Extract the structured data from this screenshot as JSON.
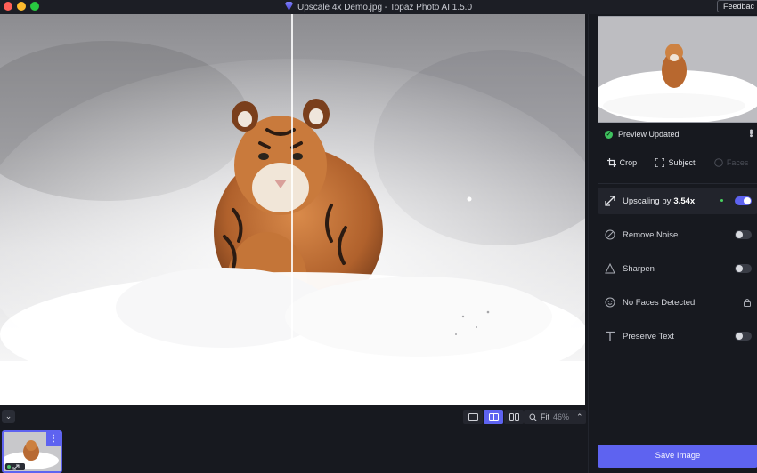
{
  "window": {
    "title": "Upscale 4x Demo.jpg - Topaz Photo AI 1.5.0",
    "feedback_label": "Feedbac"
  },
  "colors": {
    "accent": "#5e63f0",
    "success": "#3fc25f",
    "panel_bg": "#17191f"
  },
  "viewer": {
    "zoom_label": "Fit",
    "zoom_value": "46%",
    "view_modes": [
      "single-view-icon",
      "split-view-icon",
      "side-by-side-icon"
    ],
    "active_view_mode": "split-view-icon"
  },
  "panel": {
    "status": "Preview Updated",
    "tools": [
      {
        "label": "Crop",
        "icon": "crop-icon",
        "enabled": true
      },
      {
        "label": "Subject",
        "icon": "subject-icon",
        "enabled": true
      },
      {
        "label": "Faces",
        "icon": "faces-icon",
        "enabled": false
      }
    ],
    "upscale": {
      "prefix": "Upscaling by",
      "value": "3.54x",
      "enabled": true
    },
    "features": [
      {
        "label": "Remove Noise",
        "icon": "noise-icon",
        "enabled": false
      },
      {
        "label": "Sharpen",
        "icon": "sharpen-icon",
        "enabled": false
      },
      {
        "label": "No Faces Detected",
        "icon": "face-icon",
        "locked": true
      },
      {
        "label": "Preserve Text",
        "icon": "text-icon",
        "enabled": false
      }
    ],
    "save_label": "Save Image"
  }
}
